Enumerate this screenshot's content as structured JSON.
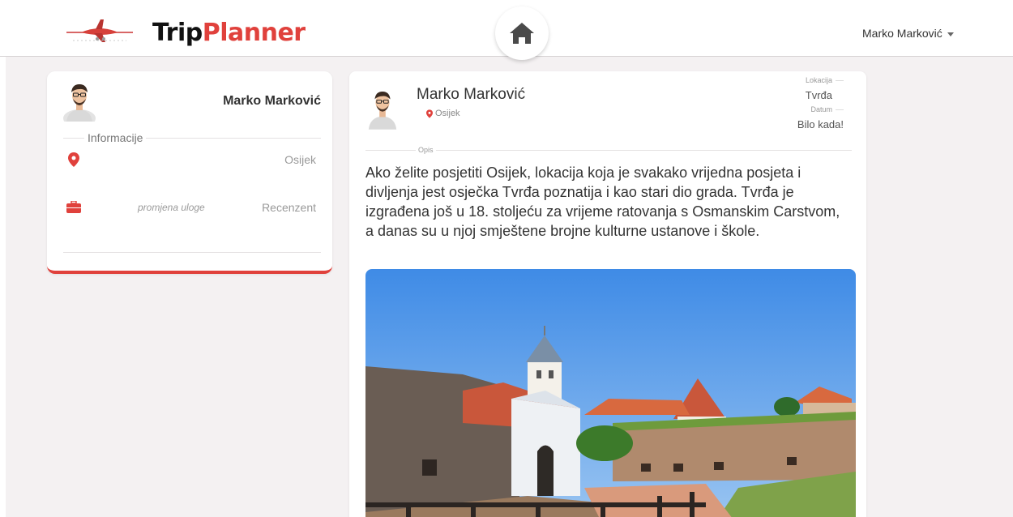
{
  "header": {
    "brand_trip": "Trip",
    "brand_planner": "Planner",
    "user_menu_label": "Marko Marković"
  },
  "profile": {
    "name": "Marko Marković",
    "section_title": "Informacije",
    "city": "Osijek",
    "role_change_action": "promjena uloge",
    "role": "Recenzent"
  },
  "post": {
    "author": "Marko Marković",
    "author_location": "Osijek",
    "location_label": "Lokacija",
    "location_value": "Tvrđa",
    "date_label": "Datum",
    "date_value": "Bilo kada!",
    "description_label": "Opis",
    "description": "Ako želite posjetiti Osijek, lokacija koja je svakako vrijedna posjeta i divljenja jest osječka Tvrđa poznatija i kao stari dio grada. Tvrđa je izgrađena još u 18. stoljeću za vrijeme ratovanja s Osmanskim Carstvom, a danas su u njoj smještene brojne kulturne ustanove i škole."
  },
  "icons": {
    "home": "home-icon",
    "location": "map-pin-icon",
    "role": "briefcase-icon",
    "dropdown": "caret-down-icon"
  },
  "colors": {
    "accent": "#e0413c",
    "background": "#f4f1f2",
    "card": "#ffffff"
  }
}
